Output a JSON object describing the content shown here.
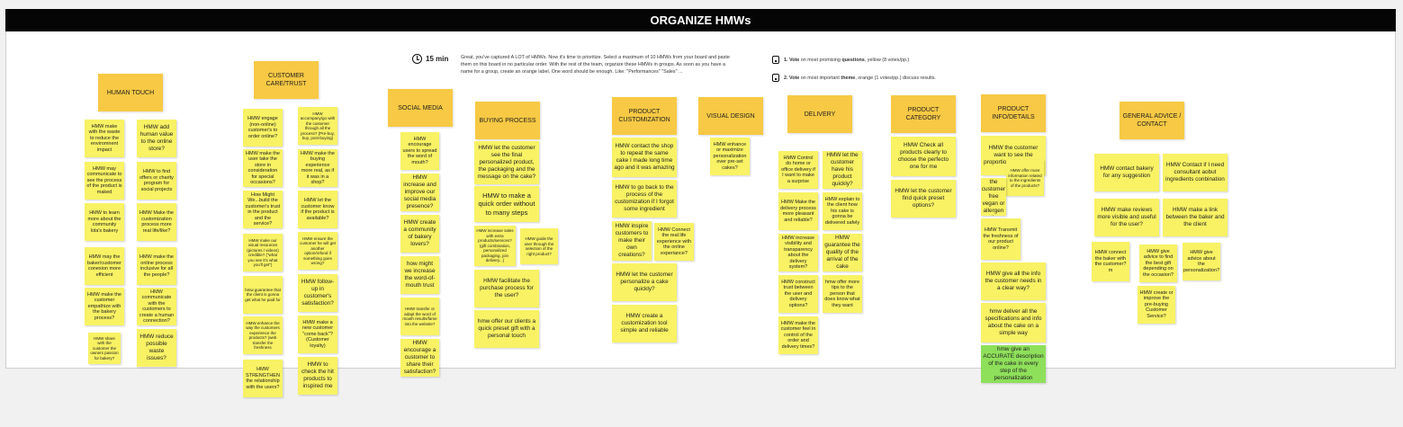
{
  "board": {
    "title": "ORGANIZE HMWs"
  },
  "timer": {
    "label": "15 min"
  },
  "instructions": "Great, you've captured A LOT of HMWs. Now it's time to prioritize. Select a maximum of 10 HMWs from your board and paste them on this board in no particular order. With the rest of the team, organize these HMWs in groups. As soon as you have a name for a group, create an orange label. One word should be enough. Like: \"Performances\" \"Sales\" ...",
  "votes": [
    {
      "num": "1.",
      "lead": "Vote",
      "mid": " on most promising ",
      "key": "questions",
      "tail": ", yellow  (8 votes/pp.)"
    },
    {
      "num": "2.",
      "lead": "Vote",
      "mid": " on most important ",
      "key": "theme",
      "tail": ", orange   (1 votes/pp.) discuss results."
    }
  ],
  "groups": [
    "HUMAN TOUCH",
    "CUSTOMER CARE/TRUST",
    "SOCIAL MEDIA",
    "BUYING PROCESS",
    "PRODUCT CUSTOMIZATION",
    "VISUAL DESIGN",
    "DELIVERY",
    "PRODUCT CATEGORY",
    "PRODUCT INFO/DETAILS",
    "GENERAL ADVICE / CONTACT"
  ],
  "notes": [
    "HMW make with the waste to reduce the enviromnent impact",
    "HMW add human value to the online store?",
    "HMW may communicate to see the process of the product is maked",
    "HMW to find offers or charity program for social projects",
    "HMW to learn more about the community lola's bakery",
    "HMW Make the customization process more real life/like?",
    "HMW may the baker/customer conexion more efficient",
    "HMW make the online process inclusive for all the people?",
    "HMW make the customer empathize with the bakery process?",
    "HMW communicate with the customers to create a human connection?",
    "HMW share with the customer the owners passion for bakery?",
    "HMW reduce possible waste issues?",
    "HMW engage (non-online) customer's to order online?",
    "HMW accompany/go with the customer through all the process? (Pre-buy, buy, post-buying)",
    "HMW make the user take the store in consideration for special occasions?",
    "HMW make the buying experience more real, as if it was in a shop?",
    "How Might We...build the customer's trust in the product and the service?",
    "HMW let the customer know if the product is available?",
    "HMW make our visual resources (pictures / videos) credible? (\"what you see it's what you'll get\")",
    "HMW ensure the customer he will get another option/refund if something goes wrong?",
    "hmw guarantee that the client is gonna get what he paid for",
    "HMW follow-up in customer's satisfaction?",
    "HMW enhance the way the customers experience the products? (web transfer the freshness",
    "HMW make a new customer \"come back\"? (Customer loyalty)",
    "HMW STRENGTHEN the relationship with the users?",
    "HMW to check the hit products to inspired me",
    "HMW encourage users to spread the word of mouth?",
    "HMW increase and improve our social media presence?",
    "HMW create a community of bakery lovers?",
    "how might we increase the word-of-mouth trust",
    "HMW transfer or adapt the word of mouth results/fame into the website?",
    "HMW encourage a customer to share their satisfaction?",
    "HMW let the customer see the final personalized product, the packaging and the message on the cake?",
    "HMW to make a quick order without to many steps",
    "HMW increase sales with extra products/services? (gift combination, personalized packaging, join delivery...)",
    "HMW guide the user through the selection of the right product?",
    "HMW facilitate the purchase process for the user?",
    "hmw offer our clients a quick preset gift with a personal touch",
    "HMW contact the shop to repeat the same cake I made long time ago and it was amazing",
    "HMW to go back to the process of the customization if I forgot some ingredient",
    "HMW inspire customers to make their own creations?",
    "HMW Connect the real life experience with the online experiance?",
    "HMW let the customer personalize a cake quickly?",
    "HMW create a customization tool simple and reliable",
    "HMW enhance or maximize personalization over pre-set cakes?",
    "HMW Control do home or office delivery if I want to make a surprise",
    "HMW let the customer have his product quickly?",
    "HMW Make the delivery process more pleasant and reliable?",
    "HMW explain to the client how his cake is gonna be delivered safely",
    "HMW increase visibility and transparency about the delivery system?",
    "HMW guarantee the quality of the arrival of the cake",
    "HMW construct trust between the user and delivery options?",
    "hmw offer more tips to the person that does know what they want",
    "HMW make the customer feel in control of the order and delivery times?",
    "HMW Check all products clearly to choose the perfecto one for me",
    "HMW let the customer find quick preset options?",
    "HMW the customer want to see the proportions to compare",
    "HMW offer more information related to the ingredients of the products?",
    "HMW the customer free vegan or allergen options",
    "HMW Transmit the freshness of our product online?",
    "HMW give all the info the customer needs in a clear way?",
    "hmw deliver all the specifications and info about the cake on a simple way",
    "hmw give an ACCURATE description of the cake in every step of the personalization",
    "HMW contact bakery for any suggestion",
    "HMW Contact if I need consultant aobut ingredients conbination",
    "HMW make reviews more visible and useful for the user?",
    "HMW make a link between the baker and the client",
    "HMW connect the baker with the customer?m",
    "HMW give advice to find the best gift depending on the occasion?",
    "HMW give advice about the personalization?",
    "HMW create or improve the pre-buying Customer Service?"
  ]
}
